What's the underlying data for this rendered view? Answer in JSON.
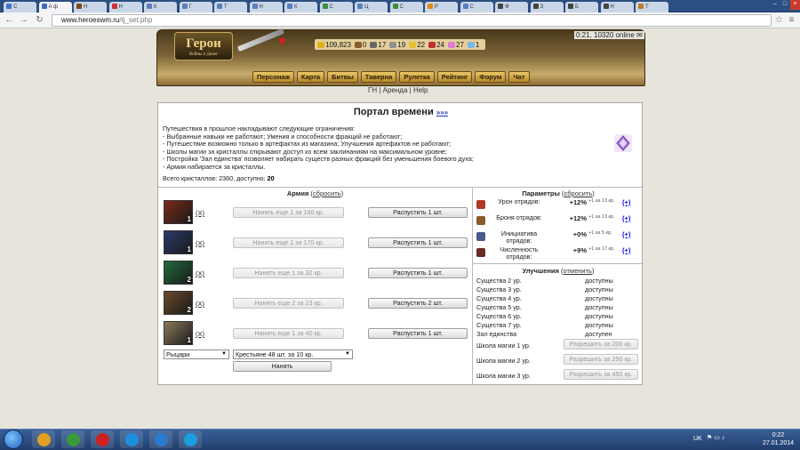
{
  "browser": {
    "tabs": [
      {
        "label": "С",
        "color": "#3a76c9"
      },
      {
        "label": "А ф",
        "color": "#3a6fc0"
      },
      {
        "label": "Н",
        "color": "#7a4a1a"
      },
      {
        "label": "Н",
        "color": "#d23030"
      },
      {
        "label": "К",
        "color": "#5b7fbf"
      },
      {
        "label": "Г",
        "color": "#5b7fbf"
      },
      {
        "label": "Т",
        "color": "#5b7fbf"
      },
      {
        "label": "Н",
        "color": "#5b7fbf"
      },
      {
        "label": "К",
        "color": "#5b7fbf"
      },
      {
        "label": "С",
        "color": "#3b8f3b"
      },
      {
        "label": "Ц",
        "color": "#5b7fbf"
      },
      {
        "label": "С",
        "color": "#3b8f3b"
      },
      {
        "label": "Р",
        "color": "#e08a1a"
      },
      {
        "label": "С",
        "color": "#5b7fbf"
      },
      {
        "label": "Ф",
        "color": "#444444"
      },
      {
        "label": "З",
        "color": "#444444"
      },
      {
        "label": "Б",
        "color": "#444444"
      },
      {
        "label": "Н",
        "color": "#444444"
      },
      {
        "label": "Т",
        "color": "#c07a2a"
      }
    ],
    "url_host": "www.heroeswm.ru",
    "url_path": "/tj_set.php"
  },
  "header": {
    "logo_text": "Герои",
    "logo_sub": "Войны и Денег",
    "online": "0:21, 10320 online",
    "resources": [
      {
        "value": "109,823",
        "icon": "gold-icon",
        "color": "#e0b020"
      },
      {
        "value": "0",
        "icon": "wood-icon",
        "color": "#8a5a2a"
      },
      {
        "value": "17",
        "icon": "ore-icon",
        "color": "#666666"
      },
      {
        "value": "19",
        "icon": "mercury-icon",
        "color": "#909090"
      },
      {
        "value": "22",
        "icon": "sulfur-icon",
        "color": "#e8c030"
      },
      {
        "value": "24",
        "icon": "crystal-icon",
        "color": "#c03030"
      },
      {
        "value": "27",
        "icon": "gems-icon",
        "color": "#e07ad0"
      },
      {
        "value": "1",
        "icon": "diamond-icon",
        "color": "#7ab8e8"
      }
    ],
    "menu": [
      "Персонаж",
      "Карта",
      "Битвы",
      "Таверна",
      "Рулетка",
      "Рейтинг",
      "Форум",
      "Чат"
    ],
    "subnav": [
      "ГН",
      "Аренда",
      "Help"
    ]
  },
  "portal": {
    "title": "Портал времени",
    "title_link": "»»»",
    "restrictions": [
      "Путешествия в прошлое накладывают следующие ограничения:",
      "- Выбранные навыки не работают; Умения и способности фракций не работают;",
      "- Путешествие возможно только в артефактах из магазина; Улучшения артефактов не работают;",
      "- Школы магии за кристаллы открывают доступ ко всем заклинаниям на максимальном уровне;",
      "- Постройка 'Зал единства' позволяет набирать существ разных фракций без уменьшения боевого духа;",
      "- Армия набирается за кристаллы."
    ],
    "crystals_label": "Всего кристаллов: 2360, доступно:",
    "crystals_available": "20"
  },
  "army": {
    "title": "Армия",
    "reset": "сбросить",
    "remove": "(X)",
    "units": [
      {
        "level": "1",
        "hire": "Нанять еще 1 за 160 кр.",
        "dismiss": "Распустить 1 шт.",
        "color": "#7a2a1a"
      },
      {
        "level": "1",
        "hire": "Нанять еще 1 за 170 кр.",
        "dismiss": "Распустить 1 шт.",
        "color": "#2a3a6a"
      },
      {
        "level": "2",
        "hire": "Нанять еще 1 за 32 кр.",
        "dismiss": "Распустить 1 шт.",
        "color": "#1f6a3a"
      },
      {
        "level": "2",
        "hire": "Нанять еще 2 за 23 кр.",
        "dismiss": "Распустить 2 шт.",
        "color": "#6a4a2a"
      },
      {
        "level": "1",
        "hire": "Нанять еще 1 за 40 кр.",
        "dismiss": "Распустить 1 шт.",
        "color": "#8a7a5a"
      }
    ],
    "faction_select": "Рыцари",
    "creature_select": "Крестьяне 48 шт. за 10 кр.",
    "hire_button": "Нанять"
  },
  "params": {
    "title": "Параметры",
    "reset": "сбросить",
    "rows": [
      {
        "label": "Урон отрядов:",
        "value": "+12%",
        "cost": "+1 за 13 кр.",
        "plus": "(+)",
        "color": "#b03a2a"
      },
      {
        "label": "Броня отрядов:",
        "value": "+12%",
        "cost": "+1 за 13 кр.",
        "plus": "(+)",
        "color": "#8a5a2a"
      },
      {
        "label": "Инициатива отрядов:",
        "value": "+0%",
        "cost": "+1 за 5 кр.",
        "plus": "(+)",
        "color": "#4a5a8a"
      },
      {
        "label": "Численность отрядов:",
        "value": "+9%",
        "cost": "+1 за 17 кр.",
        "plus": "(+)",
        "color": "#6a2a2a"
      }
    ]
  },
  "upgrades": {
    "title": "Улучшения",
    "cancel": "отменить",
    "rows": [
      {
        "label": "Существа 2 ур.",
        "status": "доступны"
      },
      {
        "label": "Существа 3 ур.",
        "status": "доступны"
      },
      {
        "label": "Существа 4 ур.",
        "status": "доступны"
      },
      {
        "label": "Существа 5 ур.",
        "status": "доступны"
      },
      {
        "label": "Существа 6 ур.",
        "status": "доступны"
      },
      {
        "label": "Существа 7 ур.",
        "status": "доступны"
      },
      {
        "label": "Зал единства",
        "status": "доступен"
      }
    ],
    "schools": [
      {
        "label": "Школа магии 1 ур.",
        "button": "Разрешить за 200 кр."
      },
      {
        "label": "Школа магии 2 ур.",
        "button": "Разрешить за 250 кр."
      },
      {
        "label": "Школа магии 3 ур.",
        "button": "Разрешить за 450 кр."
      }
    ]
  },
  "taskbar": {
    "apps": [
      {
        "name": "chrome-icon",
        "color": "#e0a020"
      },
      {
        "name": "greenapp-icon",
        "color": "#3c9a3c"
      },
      {
        "name": "opera-icon",
        "color": "#d02020"
      },
      {
        "name": "zona-icon",
        "color": "#1d8fe0"
      },
      {
        "name": "bird-icon",
        "color": "#2a7ad0"
      },
      {
        "name": "skype-icon",
        "color": "#1aa0e0"
      }
    ],
    "lang": "UK",
    "time": "0:22",
    "date": "27.01.2014"
  }
}
